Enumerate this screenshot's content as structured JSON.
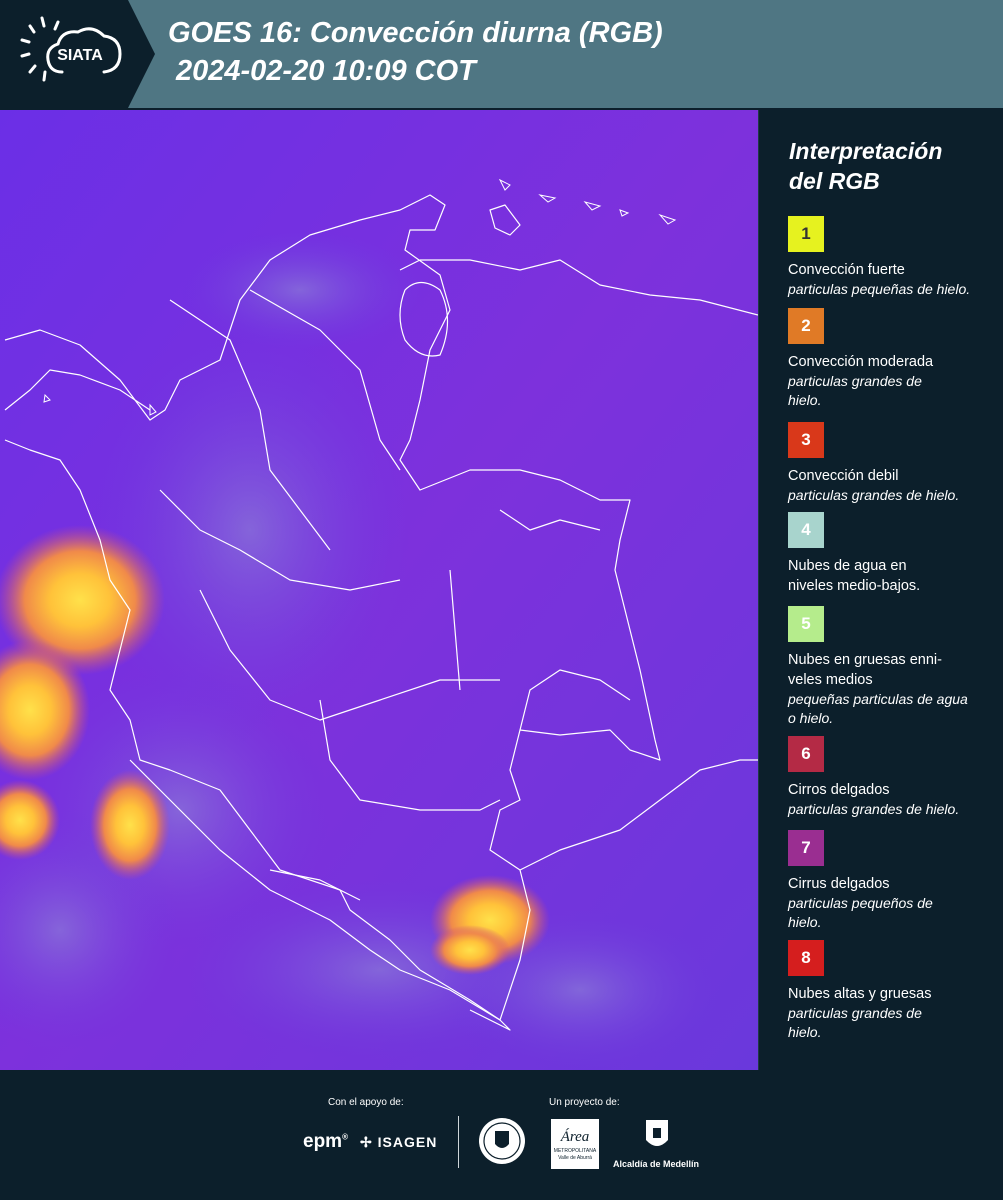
{
  "header": {
    "logo_text": "SIATA",
    "title_line1": "GOES 16: Convección diurna (RGB)",
    "title_line2": "2024-02-20 10:09 COT"
  },
  "legend": {
    "title_line1": "Interpretación",
    "title_line2": "del RGB",
    "items": [
      {
        "number": "1",
        "color": "#e6f21f",
        "text_color": "#333333",
        "label": "Convección fuerte",
        "sub": "particulas pequeñas de hielo."
      },
      {
        "number": "2",
        "color": "#e07a26",
        "text_color": "#ffffff",
        "label": "Convección moderada",
        "sub": "particulas grandes de hielo."
      },
      {
        "number": "3",
        "color": "#d9381a",
        "text_color": "#ffffff",
        "label": "Convección debil",
        "sub": "particulas grandes de hielo."
      },
      {
        "number": "4",
        "color": "#a8d4cd",
        "text_color": "#ffffff",
        "label": "Nubes de agua en niveles medio-bajos.",
        "sub": ""
      },
      {
        "number": "5",
        "color": "#b5ec8c",
        "text_color": "#ffffff",
        "label": "Nubes en gruesas enni-veles medios",
        "sub": "pequeñas particulas de agua o hielo."
      },
      {
        "number": "6",
        "color": "#b42a45",
        "text_color": "#ffffff",
        "label": "Cirros delgados",
        "sub": "particulas grandes de hielo."
      },
      {
        "number": "7",
        "color": "#9a2e91",
        "text_color": "#ffffff",
        "label": "Cirrus delgados",
        "sub": "particulas pequeños de hielo."
      },
      {
        "number": "8",
        "color": "#d51e1e",
        "text_color": "#ffffff",
        "label": "Nubes altas y gruesas",
        "sub": "particulas grandes de hielo."
      }
    ]
  },
  "footer": {
    "support_label": "Con el apoyo de:",
    "project_label": "Un proyecto de:",
    "sponsor1": "epm",
    "sponsor1_mark": "®",
    "sponsor2": "ISAGEN",
    "partner_area": "Área",
    "partner_area_sub1": "METROPOLITANA",
    "partner_area_sub2": "Valle de Aburrá",
    "partner_alcaldia": "Alcaldía de Medellín"
  },
  "colors": {
    "header_bg": "#4f7683",
    "logo_bg": "#0c1f2b",
    "panel_bg": "#0c1f2b",
    "map_purple": "#7a2fe0"
  }
}
